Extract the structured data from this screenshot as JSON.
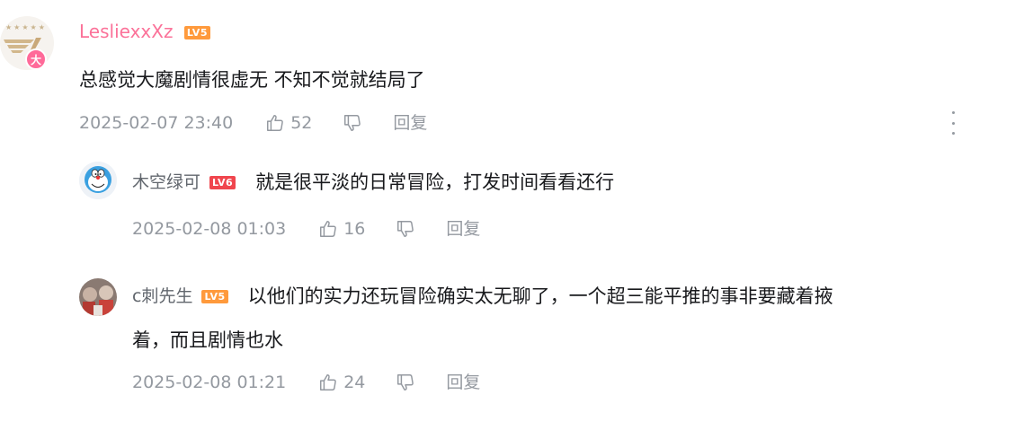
{
  "main_comment": {
    "username": "LesliexxXz",
    "level": "LV5",
    "badge": "大",
    "text": "总感觉大魔剧情很虚无 不知不觉就结局了",
    "time": "2025-02-07 23:40",
    "likes": "52",
    "reply_label": "回复"
  },
  "replies": [
    {
      "username": "木空绿可",
      "level": "LV6",
      "text": "就是很平淡的日常冒险，打发时间看看还行",
      "time": "2025-02-08 01:03",
      "likes": "16",
      "reply_label": "回复"
    },
    {
      "username": "c刺先生",
      "level": "LV5",
      "text_line1": "以他们的实力还玩冒险确实太无聊了，一个超三能平推的事非要藏着掖",
      "text_line2": "着，而且剧情也水",
      "time": "2025-02-08 01:21",
      "likes": "24",
      "reply_label": "回复"
    }
  ],
  "icons": {
    "like": "thumbs-up-icon",
    "dislike": "thumbs-down-icon",
    "more": "more-vertical-icon"
  },
  "colors": {
    "username_pink": "#fb7299",
    "meta_gray": "#9499a0",
    "lv5": "#ff9a3c",
    "lv6": "#f0464e"
  }
}
